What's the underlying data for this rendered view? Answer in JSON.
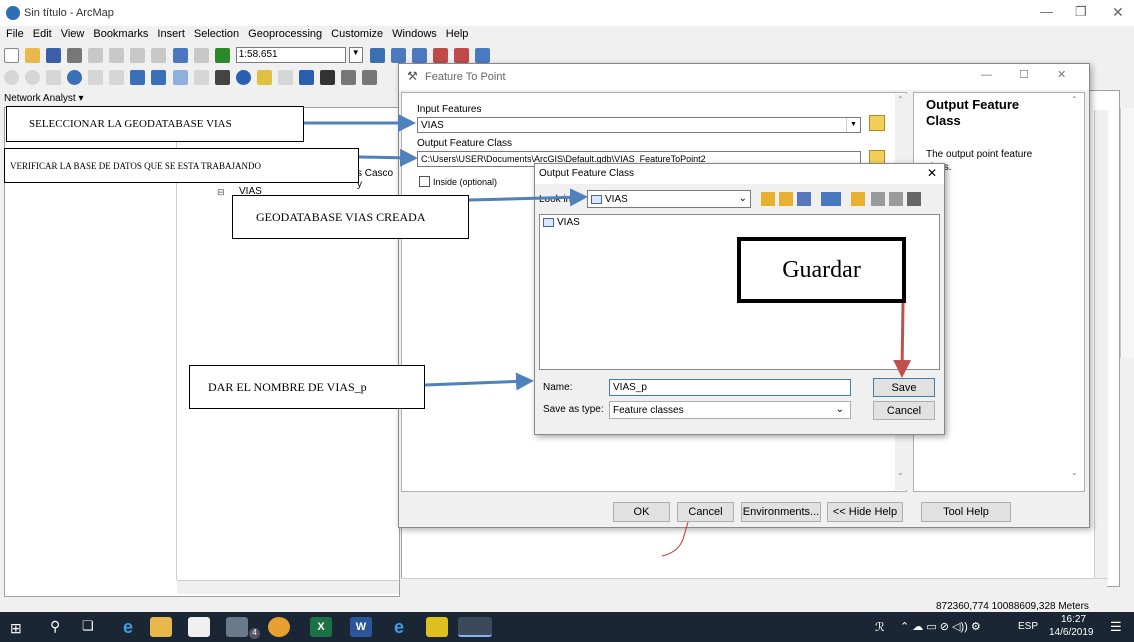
{
  "window": {
    "title": "Sin título - ArcMap"
  },
  "menu": [
    "File",
    "Edit",
    "View",
    "Bookmarks",
    "Insert",
    "Selection",
    "Geoprocessing",
    "Customize",
    "Windows",
    "Help"
  ],
  "toolbar": {
    "scale": "1:58.651"
  },
  "network_toolbar": {
    "label": "Network Analyst ▾"
  },
  "toc": {
    "layer_fragment": "s Casco y",
    "layer_name": "VIAS"
  },
  "tool_dialog": {
    "title": "Feature To Point",
    "input_features_label": "Input Features",
    "input_features_value": "VIAS",
    "output_class_label": "Output Feature Class",
    "output_class_value": "C:\\Users\\USER\\Documents\\ArcGIS\\Default.gdb\\VIAS_FeatureToPoint2",
    "inside_label": "Inside (optional)",
    "buttons": {
      "ok": "OK",
      "cancel": "Cancel",
      "environments": "Environments...",
      "hide_help": "<< Hide Help",
      "tool_help": "Tool Help"
    },
    "help_title": "Output Feature Class",
    "help_text": "The output point feature class."
  },
  "save_dialog": {
    "title": "Output Feature Class",
    "look_in_label": "Look in:",
    "look_in_value": "VIAS",
    "list_item": "VIAS",
    "name_label": "Name:",
    "name_value": "VIAS_p",
    "type_label": "Save as type:",
    "type_value": "Feature classes",
    "save_btn": "Save",
    "cancel_btn": "Cancel"
  },
  "annotations": {
    "a1": "SELECCIONAR LA GEODATABASE VIAS",
    "a2": "VERIFICAR LA BASE DE DATOS QUE SE ESTA TRABAJANDO",
    "a3": "GEODATABASE VIAS CREADA",
    "a4": "DAR EL NOMBRE DE VIAS_p",
    "guardar": "Guardar"
  },
  "status": {
    "coords": "872360,774 10088609,328 Meters"
  },
  "taskbar": {
    "lang": "ESP",
    "time": "16:27",
    "date": "14/6/2019",
    "badge": "4"
  },
  "colors": {
    "arrow": "#4f81bd",
    "red_arrow": "#c0504d",
    "taskbar": "#1a2633"
  }
}
